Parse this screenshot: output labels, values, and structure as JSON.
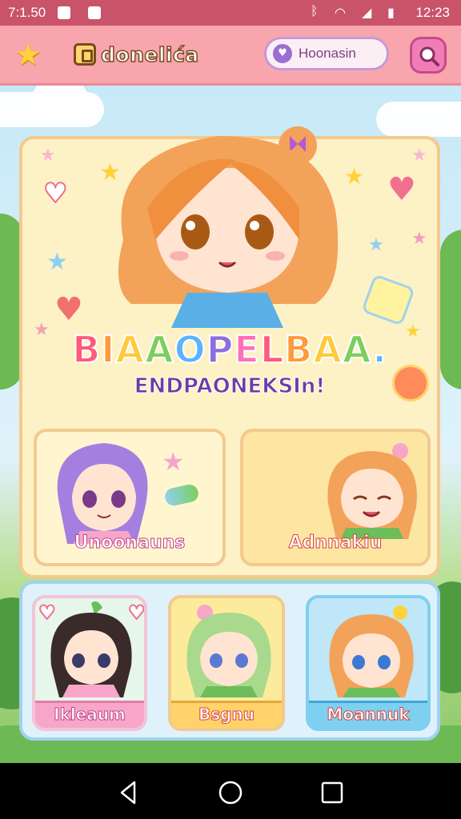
{
  "status_bar": {
    "time_left": "7:1.50",
    "time_right": "12:23",
    "icons": [
      "notification-icon",
      "photo-icon",
      "bluetooth-icon",
      "wifi-icon",
      "signal-icon",
      "battery-icon"
    ]
  },
  "app_bar": {
    "logo_text": "donelića",
    "chip_text": "Hoonasin",
    "star_icon": "star-icon",
    "search_icon": "search-icon"
  },
  "hero": {
    "title_line1": "BIAAOPELBAA.",
    "title_line2": "ENDPAONEKSIn!",
    "title_colors": [
      "#ff5a7a",
      "#ff9a3c",
      "#ffc93c",
      "#7ccf5b",
      "#5ab3ff",
      "#8b6fe0",
      "#ff6fb8"
    ],
    "cards": [
      {
        "label": "Unoonauns",
        "label_color": "#c2418a"
      },
      {
        "label": "Adnnakiu",
        "label_color": "#d8413d"
      }
    ]
  },
  "bottom_cards": [
    {
      "label": "Ikleaum",
      "label_color": "#c2418a",
      "bg": "#e6f6ea",
      "tab": "#f7a6c9"
    },
    {
      "label": "Bsgnu",
      "label_color": "#d8413d",
      "bg": "#fdeb9c",
      "tab": "#ffd36a"
    },
    {
      "label": "Moannuk",
      "label_color": "#d8413d",
      "bg": "#bfe7f7",
      "tab": "#7fcff0"
    }
  ],
  "nav": {
    "icons": [
      "back-icon",
      "home-icon",
      "recents-icon"
    ]
  }
}
